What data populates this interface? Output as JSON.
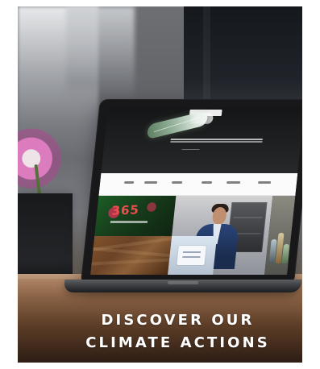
{
  "headline": {
    "line1": "DISCOVER OUR",
    "line2": "CLIMATE ACTIONS"
  },
  "colors": {
    "text": "#ffffff",
    "accent_red": "#f14d4f",
    "nav_background": "#fbfbfb"
  },
  "icons": [
    "leaf-icon"
  ]
}
